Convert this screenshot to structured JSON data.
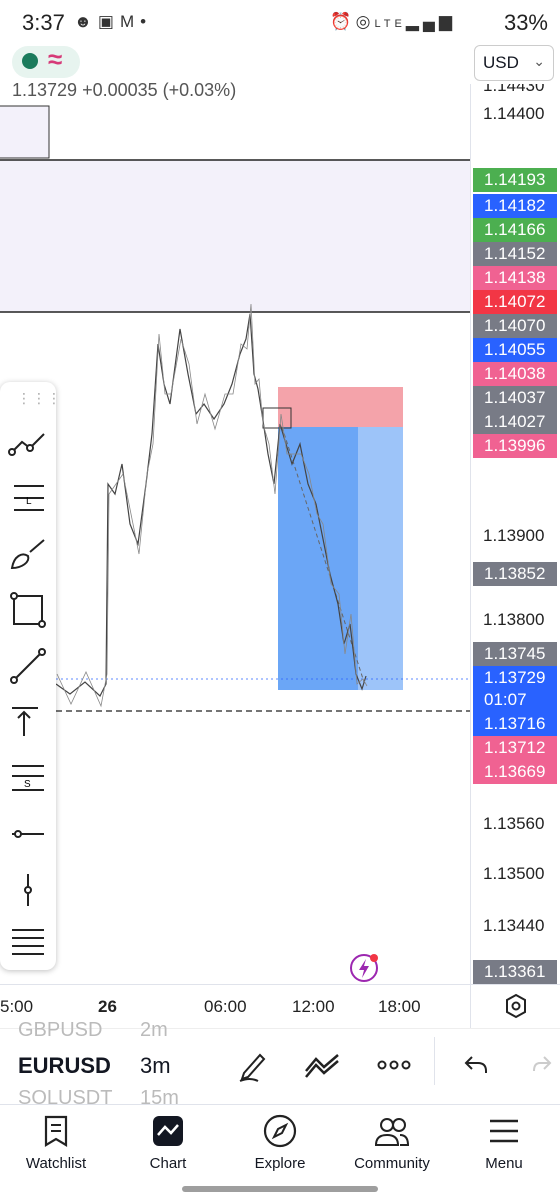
{
  "status_bar": {
    "time": "3:37",
    "battery": "33%",
    "left_icons": [
      "snapchat-icon",
      "photos-icon",
      "gmail-icon",
      "dot-icon"
    ],
    "right_icons": [
      "alarm-icon",
      "hotspot-icon",
      "lte-icon",
      "signal-icon"
    ],
    "lte_label": "LTE"
  },
  "header": {
    "indicator_wave": "≈",
    "price_line": "1.13729 +0.00035 (+0.03%)",
    "currency": "USD"
  },
  "price_axis": {
    "labels": [
      {
        "text": "1.14430"
      },
      {
        "text": "1.14400"
      },
      {
        "text": "1.13900"
      },
      {
        "text": "1.13800"
      },
      {
        "text": "1.13560"
      },
      {
        "text": "1.13500"
      },
      {
        "text": "1.13440"
      }
    ],
    "tags": [
      {
        "text": "1.14193",
        "color": "#4caf50"
      },
      {
        "text": "1.14182",
        "color": "#2962ff"
      },
      {
        "text": "1.14166",
        "color": "#4caf50"
      },
      {
        "text": "1.14152",
        "color": "#787b86"
      },
      {
        "text": "1.14138",
        "color": "#f06292"
      },
      {
        "text": "1.14072",
        "color": "#f23645"
      },
      {
        "text": "1.14070",
        "color": "#787b86"
      },
      {
        "text": "1.14055",
        "color": "#2962ff"
      },
      {
        "text": "1.14038",
        "color": "#f06292"
      },
      {
        "text": "1.14037",
        "color": "#787b86"
      },
      {
        "text": "1.14027",
        "color": "#787b86"
      },
      {
        "text": "1.13996",
        "color": "#f06292"
      },
      {
        "text": "1.13852",
        "color": "#787b86"
      },
      {
        "text": "1.13745",
        "color": "#787b86"
      },
      {
        "text": "1.13729",
        "color": "#2962ff"
      },
      {
        "text": "01:07",
        "color": "#2962ff"
      },
      {
        "text": "1.13716",
        "color": "#2962ff"
      },
      {
        "text": "1.13712",
        "color": "#f06292"
      },
      {
        "text": "1.13669",
        "color": "#f06292"
      },
      {
        "text": "1.13361",
        "color": "#787b86"
      }
    ]
  },
  "time_axis": {
    "labels": [
      "5:00",
      "26",
      "06:00",
      "12:00",
      "18:00"
    ],
    "settings_icon": "hexagon-settings-icon"
  },
  "drawing_toolbar": {
    "tools": [
      "trend-line-icon",
      "fib-retracement-icon",
      "brush-icon",
      "rectangle-icon",
      "line-icon",
      "long-position-icon",
      "text-fib-icon",
      "horizontal-ray-icon",
      "vertical-line-icon",
      "more-tools-icon"
    ]
  },
  "symbol_bar": {
    "prev_symbol": "GBPUSD",
    "prev_timeframe": "2m",
    "symbol": "EURUSD",
    "timeframe": "3m",
    "next_symbol": "SOLUSDT",
    "next_timeframe": "15m"
  },
  "bottom_nav": [
    {
      "label": "Watchlist",
      "icon": "watchlist-icon"
    },
    {
      "label": "Chart",
      "icon": "chart-icon"
    },
    {
      "label": "Explore",
      "icon": "compass-icon"
    },
    {
      "label": "Community",
      "icon": "community-icon"
    },
    {
      "label": "Menu",
      "icon": "menu-icon"
    }
  ],
  "colors": {
    "profit_zone": "#5b9cf5",
    "loss_zone": "#f4a3aa",
    "rectangle_fill": "#f3f1fa",
    "candle": "#555555"
  }
}
